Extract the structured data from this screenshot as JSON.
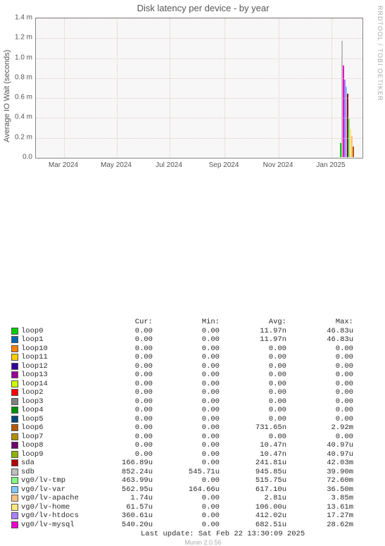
{
  "title": "Disk latency per device - by year",
  "ylabel": "Average IO Wait (seconds)",
  "watermark": "RRDTOOL / TOBI OETIKER",
  "yticks": [
    "0.0",
    "0.2 m",
    "0.4 m",
    "0.6 m",
    "0.8 m",
    "1.0 m",
    "1.2 m",
    "1.4 m"
  ],
  "xticks": [
    "Mar 2024",
    "May 2024",
    "Jul 2024",
    "Sep 2024",
    "Nov 2024",
    "Jan 2025"
  ],
  "headers": {
    "cur": "Cur:",
    "min": "Min:",
    "avg": "Avg:",
    "max": "Max:"
  },
  "devices": [
    {
      "name": "loop0",
      "color": "#00cc00",
      "cur": "0.00",
      "min": "0.00",
      "avg": "11.97n",
      "max": "46.83u"
    },
    {
      "name": "loop1",
      "color": "#0066b3",
      "cur": "0.00",
      "min": "0.00",
      "avg": "11.97n",
      "max": "46.83u"
    },
    {
      "name": "loop10",
      "color": "#ff8000",
      "cur": "0.00",
      "min": "0.00",
      "avg": "0.00",
      "max": "0.00"
    },
    {
      "name": "loop11",
      "color": "#ffcc00",
      "cur": "0.00",
      "min": "0.00",
      "avg": "0.00",
      "max": "0.00"
    },
    {
      "name": "loop12",
      "color": "#330099",
      "cur": "0.00",
      "min": "0.00",
      "avg": "0.00",
      "max": "0.00"
    },
    {
      "name": "loop13",
      "color": "#990099",
      "cur": "0.00",
      "min": "0.00",
      "avg": "0.00",
      "max": "0.00"
    },
    {
      "name": "loop14",
      "color": "#ccff00",
      "cur": "0.00",
      "min": "0.00",
      "avg": "0.00",
      "max": "0.00"
    },
    {
      "name": "loop2",
      "color": "#ff0000",
      "cur": "0.00",
      "min": "0.00",
      "avg": "0.00",
      "max": "0.00"
    },
    {
      "name": "loop3",
      "color": "#808080",
      "cur": "0.00",
      "min": "0.00",
      "avg": "0.00",
      "max": "0.00"
    },
    {
      "name": "loop4",
      "color": "#008f00",
      "cur": "0.00",
      "min": "0.00",
      "avg": "0.00",
      "max": "0.00"
    },
    {
      "name": "loop5",
      "color": "#00487d",
      "cur": "0.00",
      "min": "0.00",
      "avg": "0.00",
      "max": "0.00"
    },
    {
      "name": "loop6",
      "color": "#b35a00",
      "cur": "0.00",
      "min": "0.00",
      "avg": "731.65n",
      "max": "2.92m"
    },
    {
      "name": "loop7",
      "color": "#b38f00",
      "cur": "0.00",
      "min": "0.00",
      "avg": "0.00",
      "max": "0.00"
    },
    {
      "name": "loop8",
      "color": "#6b006b",
      "cur": "0.00",
      "min": "0.00",
      "avg": "10.47n",
      "max": "40.97u"
    },
    {
      "name": "loop9",
      "color": "#8fb300",
      "cur": "0.00",
      "min": "0.00",
      "avg": "10.47n",
      "max": "40.97u"
    },
    {
      "name": "sda",
      "color": "#b30000",
      "cur": "166.89u",
      "min": "0.00",
      "avg": "241.81u",
      "max": "42.03m"
    },
    {
      "name": "sdb",
      "color": "#bebebe",
      "cur": "852.24u",
      "min": "545.71u",
      "avg": "945.85u",
      "max": "39.90m"
    },
    {
      "name": "vg0/lv-tmp",
      "color": "#80ff80",
      "cur": "463.99u",
      "min": "0.00",
      "avg": "515.75u",
      "max": "72.60m"
    },
    {
      "name": "vg0/lv-var",
      "color": "#80c9ff",
      "cur": "562.95u",
      "min": "164.66u",
      "avg": "617.10u",
      "max": "36.50m"
    },
    {
      "name": "vg0/lv-apache",
      "color": "#ffc080",
      "cur": "1.74u",
      "min": "0.00",
      "avg": "2.81u",
      "max": "3.85m"
    },
    {
      "name": "vg0/lv-home",
      "color": "#ffe680",
      "cur": "61.57u",
      "min": "0.00",
      "avg": "106.00u",
      "max": "13.61m"
    },
    {
      "name": "vg0/lv-htdocs",
      "color": "#aa80ff",
      "cur": "360.61u",
      "min": "0.00",
      "avg": "412.02u",
      "max": "17.27m"
    },
    {
      "name": "vg0/lv-mysql",
      "color": "#ee00cc",
      "cur": "540.20u",
      "min": "0.00",
      "avg": "682.51u",
      "max": "28.62m"
    }
  ],
  "last_update": "Last update: Sat Feb 22 13:30:09 2025",
  "munin": "Munin 2.0.56",
  "chart_data": {
    "type": "line",
    "title": "Disk latency per device - by year",
    "xlabel": "",
    "ylabel": "Average IO Wait (seconds)",
    "ylim": [
      0,
      0.0015
    ],
    "x_range": [
      "2024-02",
      "2025-02"
    ],
    "note": "All series hover near 0 for most of the year with brief spikes near Feb 2025",
    "series": [
      {
        "name": "loop0",
        "avg": 1.197e-08,
        "max": 4.683e-05
      },
      {
        "name": "loop1",
        "avg": 1.197e-08,
        "max": 4.683e-05
      },
      {
        "name": "loop10",
        "avg": 0,
        "max": 0
      },
      {
        "name": "loop11",
        "avg": 0,
        "max": 0
      },
      {
        "name": "loop12",
        "avg": 0,
        "max": 0
      },
      {
        "name": "loop13",
        "avg": 0,
        "max": 0
      },
      {
        "name": "loop14",
        "avg": 0,
        "max": 0
      },
      {
        "name": "loop2",
        "avg": 0,
        "max": 0
      },
      {
        "name": "loop3",
        "avg": 0,
        "max": 0
      },
      {
        "name": "loop4",
        "avg": 0,
        "max": 0
      },
      {
        "name": "loop5",
        "avg": 0,
        "max": 0
      },
      {
        "name": "loop6",
        "avg": 7.3165e-07,
        "max": 0.00292
      },
      {
        "name": "loop7",
        "avg": 0,
        "max": 0
      },
      {
        "name": "loop8",
        "avg": 1.047e-08,
        "max": 4.097e-05
      },
      {
        "name": "loop9",
        "avg": 1.047e-08,
        "max": 4.097e-05
      },
      {
        "name": "sda",
        "avg": 0.00024181,
        "max": 0.04203
      },
      {
        "name": "sdb",
        "avg": 0.00094585,
        "max": 0.0399
      },
      {
        "name": "vg0/lv-tmp",
        "avg": 0.00051575,
        "max": 0.0726
      },
      {
        "name": "vg0/lv-var",
        "avg": 0.0006171,
        "max": 0.0365
      },
      {
        "name": "vg0/lv-apache",
        "avg": 2.81e-06,
        "max": 0.00385
      },
      {
        "name": "vg0/lv-home",
        "avg": 0.000106,
        "max": 0.01361
      },
      {
        "name": "vg0/lv-htdocs",
        "avg": 0.00041202,
        "max": 0.01727
      },
      {
        "name": "vg0/lv-mysql",
        "avg": 0.00068251,
        "max": 0.02862
      }
    ]
  }
}
